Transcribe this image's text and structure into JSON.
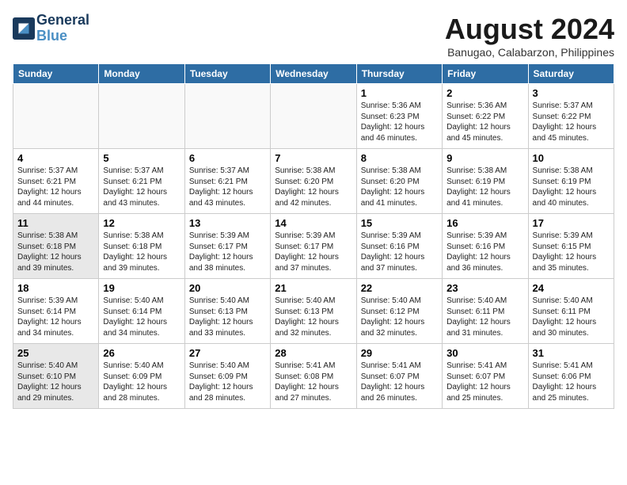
{
  "header": {
    "logo_line1": "General",
    "logo_line2": "Blue",
    "month": "August 2024",
    "location": "Banugao, Calabarzon, Philippines"
  },
  "days_of_week": [
    "Sunday",
    "Monday",
    "Tuesday",
    "Wednesday",
    "Thursday",
    "Friday",
    "Saturday"
  ],
  "weeks": [
    [
      {
        "date": "",
        "info": ""
      },
      {
        "date": "",
        "info": ""
      },
      {
        "date": "",
        "info": ""
      },
      {
        "date": "",
        "info": ""
      },
      {
        "date": "1",
        "info": "Sunrise: 5:36 AM\nSunset: 6:23 PM\nDaylight: 12 hours\nand 46 minutes."
      },
      {
        "date": "2",
        "info": "Sunrise: 5:36 AM\nSunset: 6:22 PM\nDaylight: 12 hours\nand 45 minutes."
      },
      {
        "date": "3",
        "info": "Sunrise: 5:37 AM\nSunset: 6:22 PM\nDaylight: 12 hours\nand 45 minutes."
      }
    ],
    [
      {
        "date": "4",
        "info": "Sunrise: 5:37 AM\nSunset: 6:21 PM\nDaylight: 12 hours\nand 44 minutes."
      },
      {
        "date": "5",
        "info": "Sunrise: 5:37 AM\nSunset: 6:21 PM\nDaylight: 12 hours\nand 43 minutes."
      },
      {
        "date": "6",
        "info": "Sunrise: 5:37 AM\nSunset: 6:21 PM\nDaylight: 12 hours\nand 43 minutes."
      },
      {
        "date": "7",
        "info": "Sunrise: 5:38 AM\nSunset: 6:20 PM\nDaylight: 12 hours\nand 42 minutes."
      },
      {
        "date": "8",
        "info": "Sunrise: 5:38 AM\nSunset: 6:20 PM\nDaylight: 12 hours\nand 41 minutes."
      },
      {
        "date": "9",
        "info": "Sunrise: 5:38 AM\nSunset: 6:19 PM\nDaylight: 12 hours\nand 41 minutes."
      },
      {
        "date": "10",
        "info": "Sunrise: 5:38 AM\nSunset: 6:19 PM\nDaylight: 12 hours\nand 40 minutes."
      }
    ],
    [
      {
        "date": "11",
        "info": "Sunrise: 5:38 AM\nSunset: 6:18 PM\nDaylight: 12 hours\nand 39 minutes."
      },
      {
        "date": "12",
        "info": "Sunrise: 5:38 AM\nSunset: 6:18 PM\nDaylight: 12 hours\nand 39 minutes."
      },
      {
        "date": "13",
        "info": "Sunrise: 5:39 AM\nSunset: 6:17 PM\nDaylight: 12 hours\nand 38 minutes."
      },
      {
        "date": "14",
        "info": "Sunrise: 5:39 AM\nSunset: 6:17 PM\nDaylight: 12 hours\nand 37 minutes."
      },
      {
        "date": "15",
        "info": "Sunrise: 5:39 AM\nSunset: 6:16 PM\nDaylight: 12 hours\nand 37 minutes."
      },
      {
        "date": "16",
        "info": "Sunrise: 5:39 AM\nSunset: 6:16 PM\nDaylight: 12 hours\nand 36 minutes."
      },
      {
        "date": "17",
        "info": "Sunrise: 5:39 AM\nSunset: 6:15 PM\nDaylight: 12 hours\nand 35 minutes."
      }
    ],
    [
      {
        "date": "18",
        "info": "Sunrise: 5:39 AM\nSunset: 6:14 PM\nDaylight: 12 hours\nand 34 minutes."
      },
      {
        "date": "19",
        "info": "Sunrise: 5:40 AM\nSunset: 6:14 PM\nDaylight: 12 hours\nand 34 minutes."
      },
      {
        "date": "20",
        "info": "Sunrise: 5:40 AM\nSunset: 6:13 PM\nDaylight: 12 hours\nand 33 minutes."
      },
      {
        "date": "21",
        "info": "Sunrise: 5:40 AM\nSunset: 6:13 PM\nDaylight: 12 hours\nand 32 minutes."
      },
      {
        "date": "22",
        "info": "Sunrise: 5:40 AM\nSunset: 6:12 PM\nDaylight: 12 hours\nand 32 minutes."
      },
      {
        "date": "23",
        "info": "Sunrise: 5:40 AM\nSunset: 6:11 PM\nDaylight: 12 hours\nand 31 minutes."
      },
      {
        "date": "24",
        "info": "Sunrise: 5:40 AM\nSunset: 6:11 PM\nDaylight: 12 hours\nand 30 minutes."
      }
    ],
    [
      {
        "date": "25",
        "info": "Sunrise: 5:40 AM\nSunset: 6:10 PM\nDaylight: 12 hours\nand 29 minutes."
      },
      {
        "date": "26",
        "info": "Sunrise: 5:40 AM\nSunset: 6:09 PM\nDaylight: 12 hours\nand 28 minutes."
      },
      {
        "date": "27",
        "info": "Sunrise: 5:40 AM\nSunset: 6:09 PM\nDaylight: 12 hours\nand 28 minutes."
      },
      {
        "date": "28",
        "info": "Sunrise: 5:41 AM\nSunset: 6:08 PM\nDaylight: 12 hours\nand 27 minutes."
      },
      {
        "date": "29",
        "info": "Sunrise: 5:41 AM\nSunset: 6:07 PM\nDaylight: 12 hours\nand 26 minutes."
      },
      {
        "date": "30",
        "info": "Sunrise: 5:41 AM\nSunset: 6:07 PM\nDaylight: 12 hours\nand 25 minutes."
      },
      {
        "date": "31",
        "info": "Sunrise: 5:41 AM\nSunset: 6:06 PM\nDaylight: 12 hours\nand 25 minutes."
      }
    ]
  ]
}
